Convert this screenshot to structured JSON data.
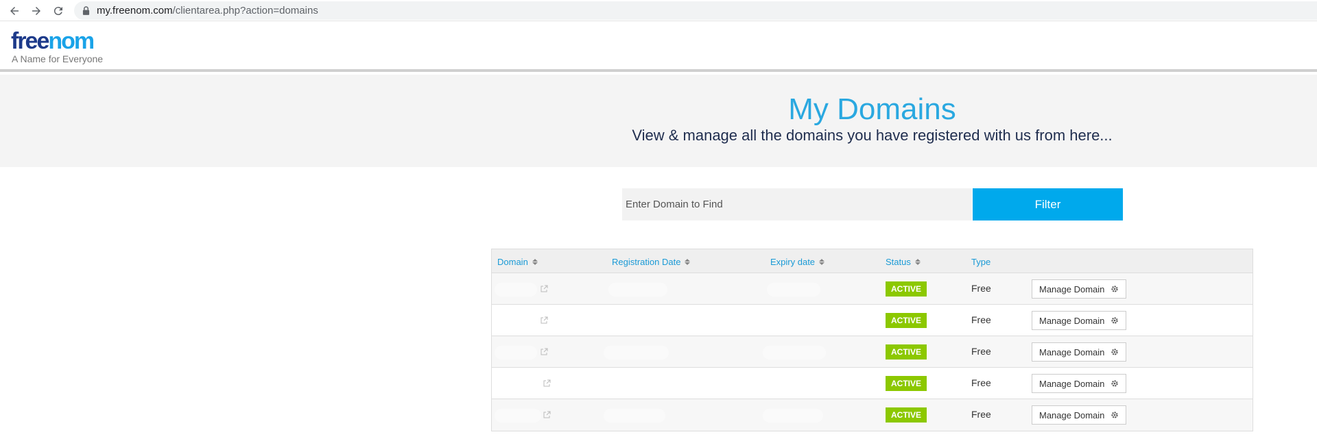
{
  "browser": {
    "url_host": "my.freenom.com",
    "url_path": "/clientarea.php?action=domains"
  },
  "header": {
    "logo_part1": "free",
    "logo_part2": "nom",
    "tagline": "A Name for Everyone"
  },
  "hero": {
    "title": "My Domains",
    "subtitle": "View & manage all the domains you have registered with us from here..."
  },
  "filter": {
    "placeholder": "Enter Domain to Find",
    "button_label": "Filter"
  },
  "table": {
    "columns": [
      "Domain",
      "Registration Date",
      "Expiry date",
      "Status",
      "Type"
    ],
    "rows": [
      {
        "status": "ACTIVE",
        "type": "Free",
        "action": "Manage Domain"
      },
      {
        "status": "ACTIVE",
        "type": "Free",
        "action": "Manage Domain"
      },
      {
        "status": "ACTIVE",
        "type": "Free",
        "action": "Manage Domain"
      },
      {
        "status": "ACTIVE",
        "type": "Free",
        "action": "Manage Domain"
      },
      {
        "status": "ACTIVE",
        "type": "Free",
        "action": "Manage Domain"
      }
    ]
  },
  "colors": {
    "accent": "#00a9ec",
    "title": "#2aa8e0",
    "active_badge": "#8cc800",
    "logo_dark": "#1d3a8a"
  }
}
